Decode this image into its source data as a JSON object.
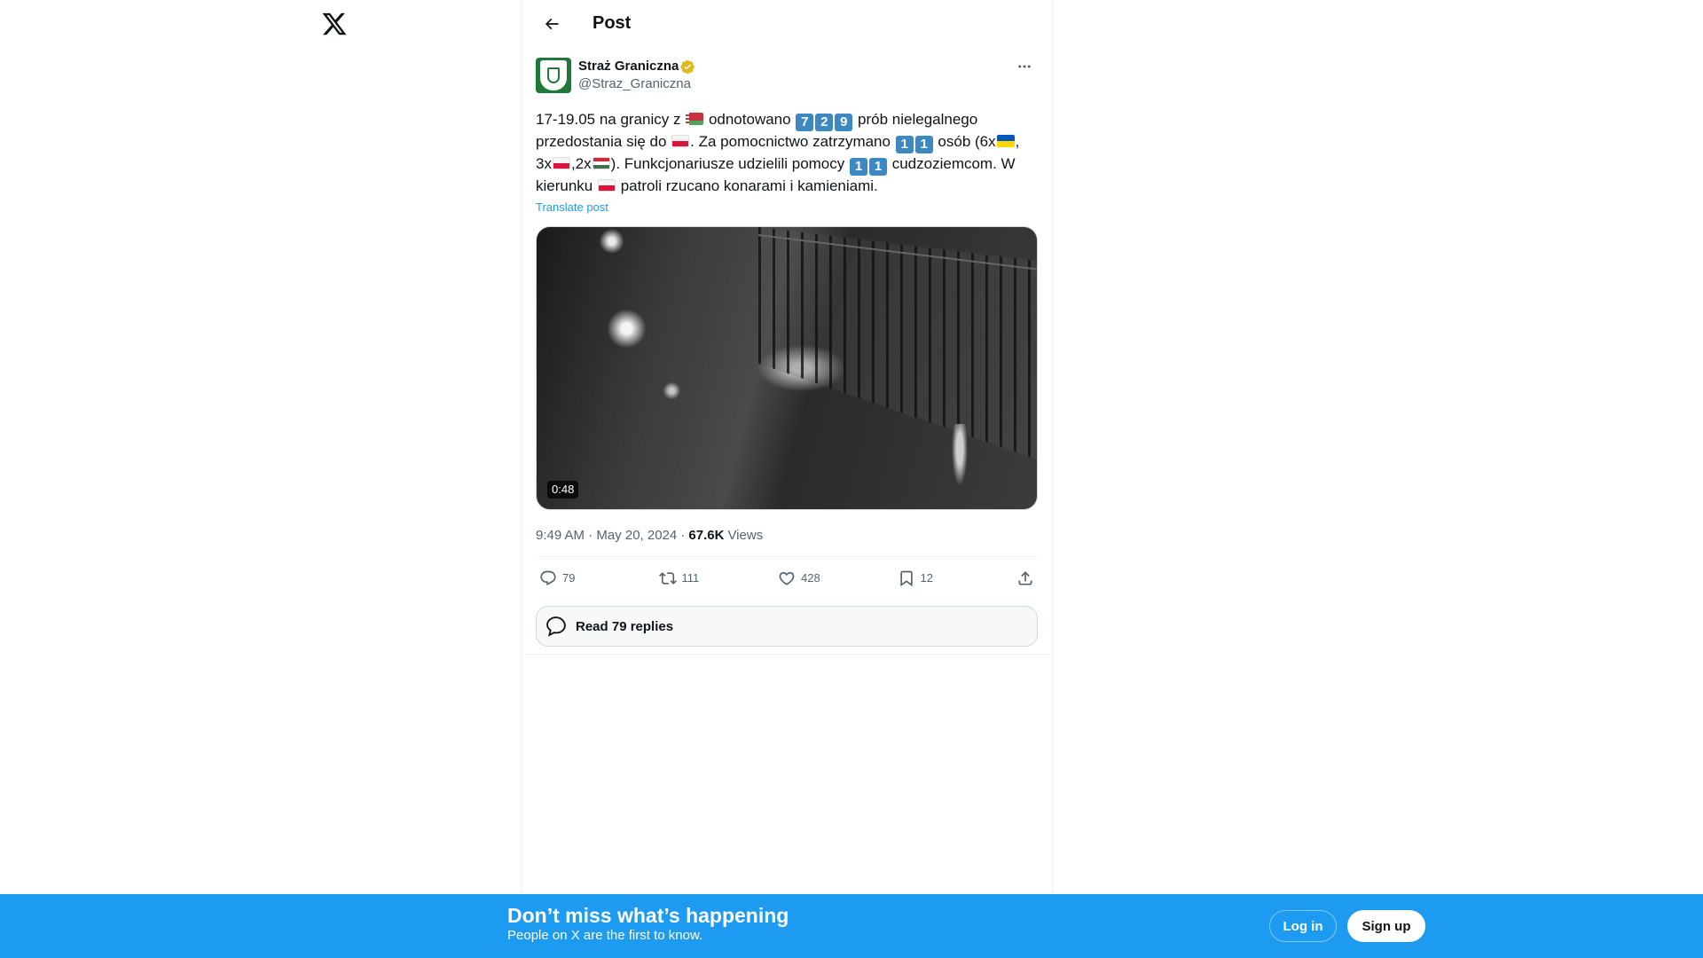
{
  "header": {
    "title": "Post"
  },
  "post": {
    "display_name": "Straż Graniczna",
    "handle": "@Straz_Graniczna",
    "text": {
      "s1": "17-19.05 na granicy z ",
      "s2": " odnotowano ",
      "k1": "7",
      "k2": "2",
      "k3": "9",
      "s3": " prób nielegalnego przedostania się do ",
      "s4": ". Za pomocnictwo zatrzymano ",
      "k4": "1",
      "k5": "1",
      "s5": " osób (6x",
      "s6": ", 3x",
      "s7": ",2x",
      "s8": "). Funkcjonariusze udzielili pomocy ",
      "k6": "1",
      "k7": "1",
      "s9": " cudzoziemcom. W kierunku ",
      "s10": " patroli rzucano konarami i kamieniami."
    },
    "translate_label": "Translate post",
    "video_duration": "0:48",
    "timestamp": "9:49 AM · May 20, 2024 ·",
    "views_count": "67.6K",
    "views_label": "Views",
    "stats": {
      "replies": "79",
      "reposts": "111",
      "likes": "428",
      "bookmarks": "12"
    },
    "read_replies_label": "Read 79 replies"
  },
  "banner": {
    "title": "Don’t miss what’s happening",
    "subtitle": "People on X are the first to know.",
    "login_label": "Log in",
    "signup_label": "Sign up"
  },
  "icons": [
    "x-logo-icon",
    "back-arrow-icon",
    "verified-badge-icon",
    "more-icon",
    "reply-icon",
    "repost-icon",
    "like-icon",
    "bookmark-icon",
    "share-icon",
    "replies-bubble-icon"
  ],
  "colors": {
    "accent": "#1d9bf0",
    "verified": "#e2b719",
    "text": "#0f1419",
    "muted": "#536471"
  }
}
